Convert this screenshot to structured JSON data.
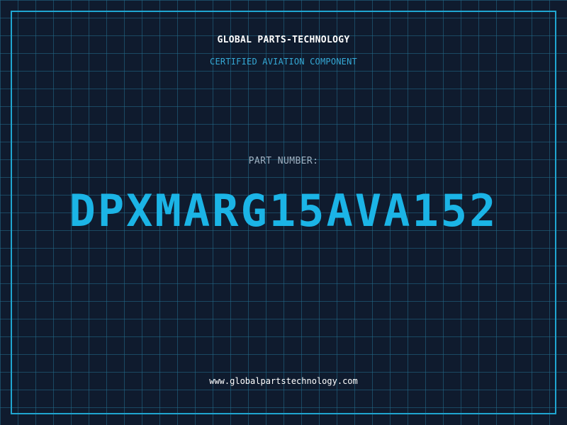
{
  "header": {
    "company_name": "GLOBAL PARTS-TECHNOLOGY",
    "subtitle": "CERTIFIED AVIATION COMPONENT"
  },
  "part": {
    "label": "PART NUMBER:",
    "number": "DPXMARG15AVA152"
  },
  "footer": {
    "website": "www.globalpartstechnology.com"
  },
  "colors": {
    "background": "#0f1b2e",
    "grid": "#226e8c",
    "accent": "#1bb4e6",
    "frame": "#1fa6d1",
    "label": "#9fb0c0"
  }
}
